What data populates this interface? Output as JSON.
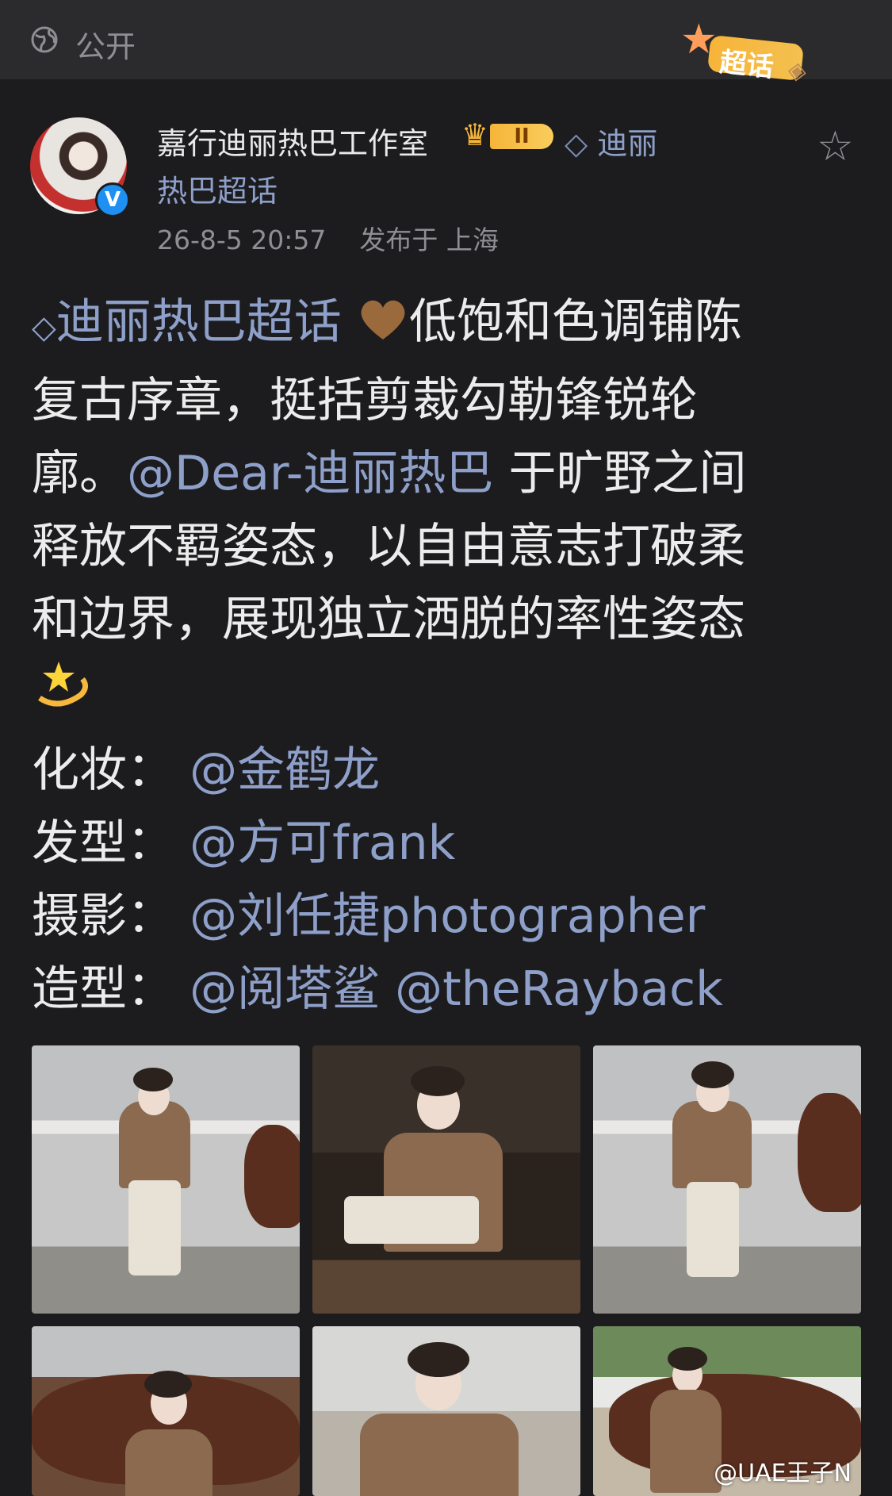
{
  "topbar": {
    "visibility_label": "公开",
    "badge_label": "超话"
  },
  "post": {
    "author": "嘉行迪丽热巴工作室",
    "level_badge": "II",
    "topic_line1": "迪丽",
    "topic_line2": "热巴超话",
    "timestamp": "26-8-5 20:57",
    "location": "发布于 上海",
    "verified_mark": "V",
    "body": {
      "topic_tag": "迪丽热巴超话",
      "text1": "低饱和色调铺陈",
      "line2": "复古序章，挺括剪裁勾勒锋锐轮",
      "line3a": "廓。",
      "mention": "@Dear-迪丽热巴",
      "line3b": " 于旷野之间",
      "line4": "释放不羁姿态，以自由意志打破柔",
      "line5": "和边界，展现独立洒脱的率性姿态"
    },
    "credits": [
      {
        "role": "化妆：",
        "names": "@金鹤龙"
      },
      {
        "role": "发型：",
        "names": "@方可frank"
      },
      {
        "role": "摄影：",
        "names": "@刘任捷photographer"
      },
      {
        "role": "造型：",
        "names": "@阅塔鲨 @theRayback"
      }
    ]
  },
  "watermark": "@UAE王子N",
  "icons": [
    "globe-icon",
    "star-icon",
    "crown-icon",
    "diamond-icon",
    "verified-icon",
    "heart-emoji",
    "dizzy-emoji"
  ],
  "colors": {
    "background": "#1c1c1e",
    "link": "#8ea0c9",
    "badge_gold": "#f5b53a"
  }
}
